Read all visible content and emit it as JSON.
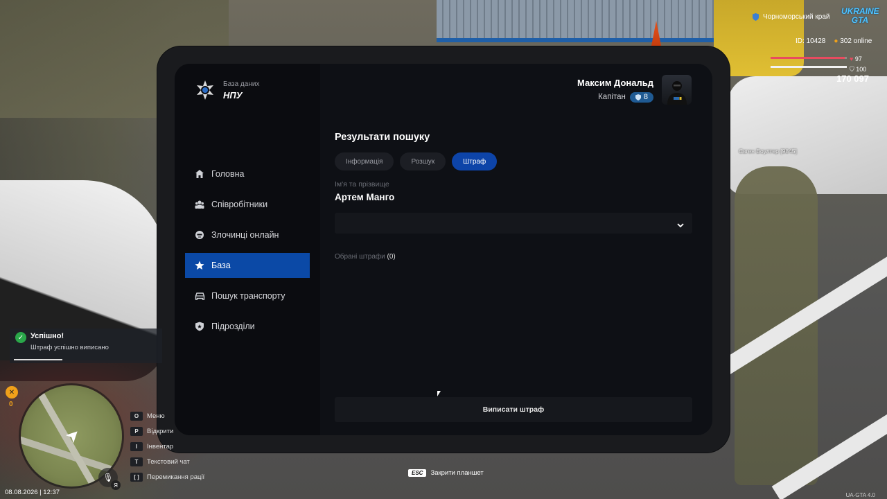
{
  "tablet": {
    "logo_subtitle": "База даних",
    "logo_title": "НПУ",
    "profile": {
      "name": "Максим Дональд",
      "rank": "Капітан",
      "level": "8"
    },
    "nav": [
      {
        "label": "Головна",
        "icon": "home-icon"
      },
      {
        "label": "Співробітники",
        "icon": "employees-icon"
      },
      {
        "label": "Злочинці онлайн",
        "icon": "criminal-icon"
      },
      {
        "label": "База",
        "icon": "star-icon",
        "active": true
      },
      {
        "label": "Пошук транспорту",
        "icon": "car-icon"
      },
      {
        "label": "Підрозділи",
        "icon": "shield-icon"
      }
    ],
    "main": {
      "title": "Результати пошуку",
      "tabs": [
        "Інформація",
        "Розшук",
        "Штраф"
      ],
      "active_tab": "Штраф",
      "field_label": "Ім'я та прізвище",
      "person_name": "Артем Манго",
      "selected_label": "Обрані штрафи",
      "selected_count": "(0)",
      "issue_button": "Виписати штраф"
    }
  },
  "hud": {
    "region": "Чорноморський край",
    "game_logo": "UKRAINE GTA",
    "player_id": "ID: 10428",
    "online": "302 online",
    "health": "97",
    "armor": "100",
    "money": "170 097",
    "food": "0",
    "nametag": "Євген Воултер [9845]",
    "notification": {
      "title": "Успішно!",
      "text": "Штраф успішно виписано"
    },
    "keys": [
      {
        "key": "O",
        "label": "Меню"
      },
      {
        "key": "P",
        "label": "Відкрити"
      },
      {
        "key": "I",
        "label": "Інвентар"
      },
      {
        "key": "T",
        "label": "Текстовий чат"
      },
      {
        "key": "[ ]",
        "label": "Перемикання рації"
      }
    ],
    "mic_key": "Я",
    "esc_key": "ESC",
    "esc_label": "Закрити планшет",
    "datetime": "08.08.2026 | 12:37",
    "version": "UA-GTA 4.0"
  },
  "colors": {
    "accent": "#0b49a6",
    "tab_active": "#0d44a8",
    "badge": "#1f5a93",
    "success": "#2aa74a"
  }
}
